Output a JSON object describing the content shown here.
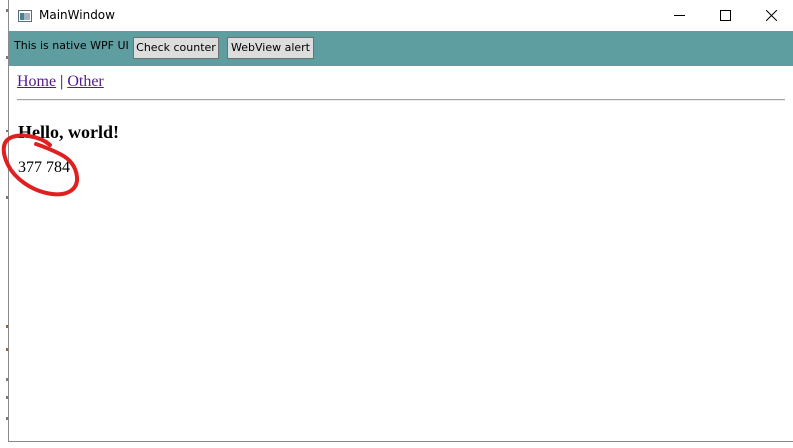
{
  "window": {
    "title": "MainWindow",
    "icon": "app-window-icon",
    "controls": [
      "minimize-icon",
      "maximize-icon",
      "close-icon"
    ]
  },
  "toolbar": {
    "background": "#5f9ea0",
    "label": "This is native WPF UI",
    "check_counter_label": "Check counter",
    "webview_alert_label": "WebView alert"
  },
  "webview": {
    "nav": {
      "home_label": "Home",
      "separator": "|",
      "other_label": "Other"
    },
    "heading": "Hello, world!",
    "counter": "377 784"
  },
  "annotation": {
    "type": "hand-drawn-circle",
    "color": "#e02020"
  }
}
